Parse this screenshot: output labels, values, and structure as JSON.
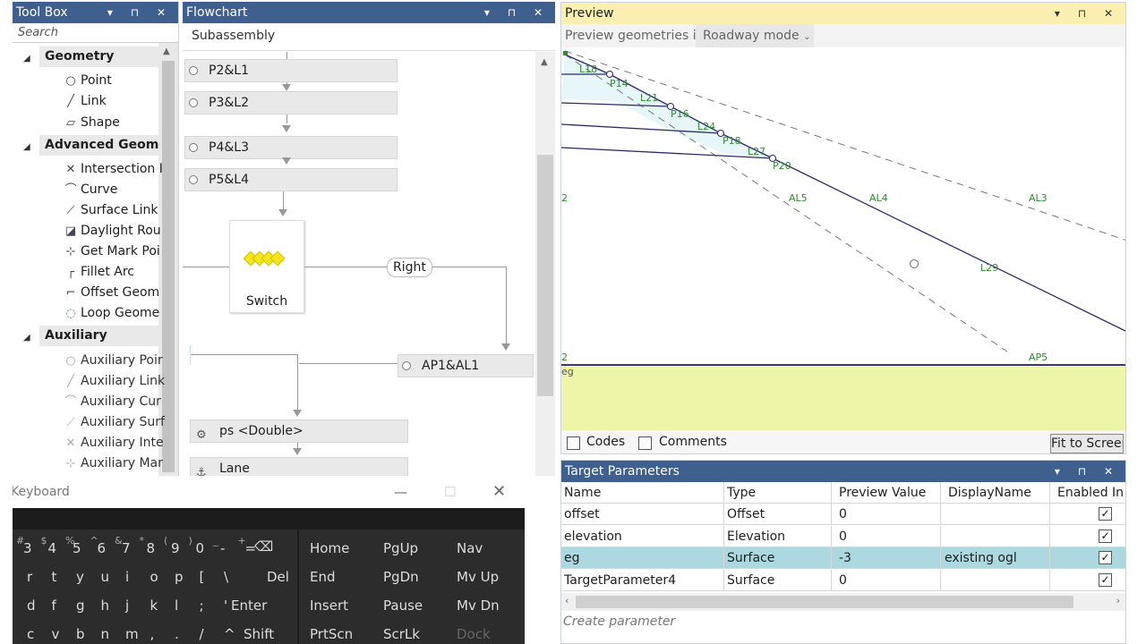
{
  "toolbox": {
    "title": "Tool Box",
    "search_placeholder": "Search",
    "categories": [
      {
        "label": "Geometry",
        "items": [
          {
            "label": "Point",
            "icon": "point-icon"
          },
          {
            "label": "Link",
            "icon": "link-icon"
          },
          {
            "label": "Shape",
            "icon": "shape-icon"
          }
        ]
      },
      {
        "label": "Advanced Geomet",
        "items": [
          {
            "label": "Intersection I",
            "icon": "intersection-icon"
          },
          {
            "label": "Curve",
            "icon": "curve-icon"
          },
          {
            "label": "Surface Link",
            "icon": "surface-link-icon"
          },
          {
            "label": "Daylight Rou",
            "icon": "daylight-icon"
          },
          {
            "label": "Get Mark Poi",
            "icon": "mark-point-icon"
          },
          {
            "label": "Fillet Arc",
            "icon": "fillet-arc-icon"
          },
          {
            "label": "Offset Geom",
            "icon": "offset-icon"
          },
          {
            "label": "Loop Geome",
            "icon": "loop-icon"
          }
        ]
      },
      {
        "label": "Auxiliary",
        "items": [
          {
            "label": "Auxiliary Poir",
            "icon": "aux-point-icon"
          },
          {
            "label": "Auxiliary Link",
            "icon": "aux-link-icon"
          },
          {
            "label": "Auxiliary Cur",
            "icon": "aux-curve-icon"
          },
          {
            "label": "Auxiliary Surf",
            "icon": "aux-surface-icon"
          },
          {
            "label": "Auxiliary Inte",
            "icon": "aux-intersection-icon"
          },
          {
            "label": "Auxiliary Mar",
            "icon": "aux-mark-icon"
          }
        ]
      }
    ]
  },
  "flowchart": {
    "title": "Flowchart",
    "subtitle": "Subassembly",
    "nodes": [
      "P2&L1",
      "P3&L2",
      "P4&L3",
      "P5&L4"
    ],
    "switch_label": "Switch",
    "right_label": "Right",
    "ap_node": "AP1&AL1",
    "ps_node": "ps <Double>",
    "lane_node": "Lane"
  },
  "keyboard": {
    "title": "Keyboard",
    "num_row": [
      "3",
      "4",
      "5",
      "6",
      "7",
      "8",
      "9",
      "0",
      "-",
      "="
    ],
    "num_row_shift": [
      "#",
      "$",
      "%",
      "^",
      "&",
      "*",
      "(",
      ")",
      "_",
      "+"
    ],
    "row2": [
      "r",
      "t",
      "y",
      "u",
      "i",
      "o",
      "p",
      "[",
      "\\",
      "Del"
    ],
    "row3": [
      "d",
      "f",
      "g",
      "h",
      "j",
      "k",
      "l",
      ";",
      "'",
      "Enter"
    ],
    "row4": [
      "c",
      "v",
      "b",
      "n",
      "m",
      ",",
      ".",
      "/",
      "^",
      "Shift"
    ],
    "backspace": "⌫",
    "nav_keys": [
      [
        "Home",
        "PgUp",
        "Nav"
      ],
      [
        "End",
        "PgDn",
        "Mv Up"
      ],
      [
        "Insert",
        "Pause",
        "Mv Dn"
      ],
      [
        "PrtScn",
        "ScrLk",
        "Dock"
      ]
    ]
  },
  "preview": {
    "title": "Preview",
    "geom_label": "Preview geometries in",
    "mode": "Roadway mode",
    "labels": [
      "L18",
      "P14",
      "L21",
      "P16",
      "L24",
      "P18",
      "L27",
      "P20",
      "AL5",
      "AL4",
      "AL3",
      "L29",
      "AP5",
      "eg",
      "2",
      "2"
    ],
    "codes_label": "Codes",
    "comments_label": "Comments",
    "fit_label": "Fit to Screen",
    "colors": {
      "line": "#2b2b6b",
      "label": "#2e8b2e",
      "ground": "#eef5a8"
    }
  },
  "targets": {
    "title": "Target Parameters",
    "columns": [
      "Name",
      "Type",
      "Preview Value",
      "DisplayName",
      "Enabled In P"
    ],
    "rows": [
      {
        "name": "offset",
        "type": "Offset",
        "value": "0",
        "display": "",
        "enabled": "✓"
      },
      {
        "name": "elevation",
        "type": "Elevation",
        "value": "0",
        "display": "",
        "enabled": "✓"
      },
      {
        "name": "eg",
        "type": "Surface",
        "value": "-3",
        "display": "existing ogl",
        "enabled": "✓"
      },
      {
        "name": "TargetParameter4",
        "type": "Surface",
        "value": "0",
        "display": "",
        "enabled": "✓"
      }
    ],
    "create_placeholder": "Create parameter"
  }
}
